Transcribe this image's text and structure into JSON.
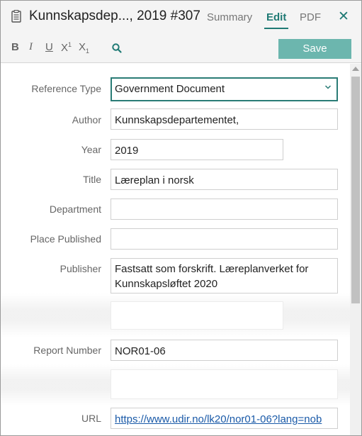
{
  "header": {
    "title": "Kunnskapsdep..., 2019 #307",
    "tabs": [
      {
        "label": "Summary",
        "active": false
      },
      {
        "label": "Edit",
        "active": true
      },
      {
        "label": "PDF",
        "active": false
      }
    ],
    "close_glyph": "✕"
  },
  "toolbar": {
    "bold": "B",
    "italic": "I",
    "underline": "U",
    "superscript_base": "X",
    "superscript_mark": "1",
    "subscript_base": "X",
    "subscript_mark": "1",
    "save_label": "Save"
  },
  "form": {
    "reference_type": {
      "label": "Reference Type",
      "value": "Government Document"
    },
    "author": {
      "label": "Author",
      "value": "Kunnskapsdepartementet,"
    },
    "year": {
      "label": "Year",
      "value": "2019"
    },
    "title": {
      "label": "Title",
      "value": "Læreplan i norsk"
    },
    "department": {
      "label": "Department",
      "value": ""
    },
    "place_published": {
      "label": "Place Published",
      "value": ""
    },
    "publisher": {
      "label": "Publisher",
      "value": "Fastsatt som forskrift. Læreplanverket for Kunnskapsløftet 2020"
    },
    "report_number": {
      "label": "Report Number",
      "value": "NOR01-06"
    },
    "url": {
      "label": "URL",
      "value": "https://www.udir.no/lk20/nor01-06?lang=nob"
    }
  },
  "colors": {
    "accent": "#1f7a74",
    "save_button": "#6cb6ae",
    "link": "#1a5aa8"
  },
  "icons": {
    "document": "clipboard-icon",
    "search": "search-icon",
    "close": "close-icon",
    "dropdown": "chevron-down-icon"
  }
}
